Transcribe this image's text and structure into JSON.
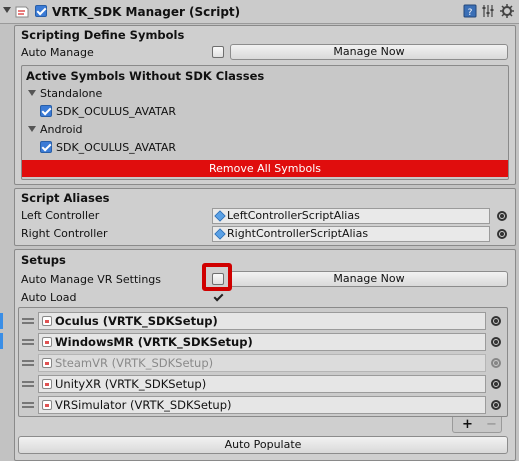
{
  "header": {
    "title": "VRTK_SDK Manager (Script)",
    "enabled": true,
    "icons": [
      "book-help-icon",
      "sliders-icon",
      "gear-icon"
    ]
  },
  "scripting_define_symbols": {
    "heading": "Scripting Define Symbols",
    "auto_manage_label": "Auto Manage",
    "auto_manage_checked": false,
    "manage_now_label": "Manage Now"
  },
  "active_symbols": {
    "heading": "Active Symbols Without SDK Classes",
    "groups": [
      {
        "name": "Standalone",
        "symbol": "SDK_OCULUS_AVATAR",
        "checked": true
      },
      {
        "name": "Android",
        "symbol": "SDK_OCULUS_AVATAR",
        "checked": true
      }
    ],
    "remove_all_label": "Remove All Symbols",
    "remove_all_color": "#e00d0d"
  },
  "script_aliases": {
    "heading": "Script Aliases",
    "left_label": "Left Controller",
    "left_value": "LeftControllerScriptAlias",
    "right_label": "Right Controller",
    "right_value": "RightControllerScriptAlias"
  },
  "setups": {
    "heading": "Setups",
    "auto_manage_vr_label": "Auto Manage VR Settings",
    "auto_manage_vr_checked": false,
    "manage_now_label": "Manage Now",
    "auto_load_label": "Auto Load",
    "auto_load_checked": true,
    "list": [
      {
        "label": "Oculus (VRTK_SDKSetup)",
        "bold": true,
        "enabled": true
      },
      {
        "label": "WindowsMR (VRTK_SDKSetup)",
        "bold": true,
        "enabled": true
      },
      {
        "label": "SteamVR (VRTK_SDKSetup)",
        "bold": false,
        "enabled": false
      },
      {
        "label": "UnityXR (VRTK_SDKSetup)",
        "bold": false,
        "enabled": true
      },
      {
        "label": "VRSimulator (VRTK_SDKSetup)",
        "bold": false,
        "enabled": true
      }
    ],
    "add_label": "+",
    "remove_label": "−",
    "auto_populate_label": "Auto Populate",
    "highlight_color": "#d00000"
  }
}
